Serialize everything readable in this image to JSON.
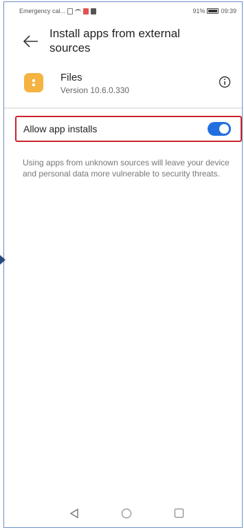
{
  "status_bar": {
    "carrier": "Emergency cal...",
    "battery": "91%",
    "time": "09:39"
  },
  "header": {
    "title": "Install apps from external sources",
    "back_icon": "arrow-left-icon"
  },
  "app": {
    "name": "Files",
    "version": "Version 10.6.0.330",
    "info_icon": "info-icon"
  },
  "setting": {
    "label": "Allow app installs",
    "enabled": true,
    "accent_color": "#1f6fe0",
    "highlight_color": "#c8232e"
  },
  "description": "Using apps from unknown sources will leave your device and personal data more vulnerable to security threats.",
  "nav": {
    "back": "triangle-back-icon",
    "home": "circle-home-icon",
    "recents": "square-recents-icon"
  }
}
